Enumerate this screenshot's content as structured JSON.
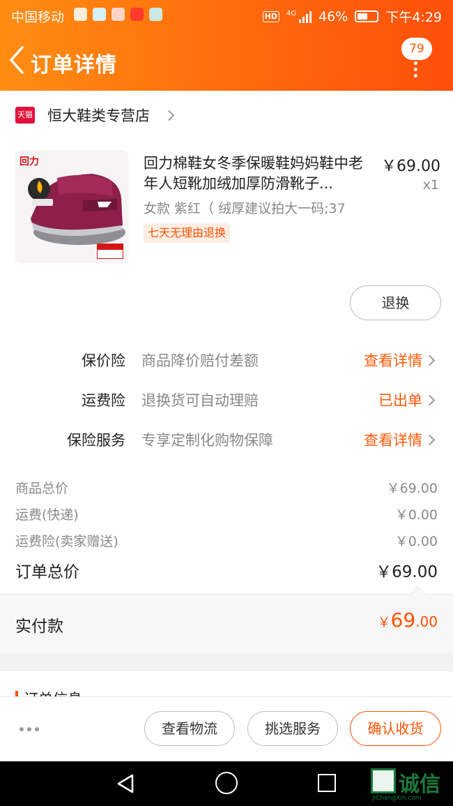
{
  "status_bar": {
    "carrier": "中国移动",
    "hd": "HD",
    "network": "4G",
    "battery": "46%",
    "time": "下午4:29"
  },
  "nav": {
    "title": "订单详情",
    "message_count": "79"
  },
  "shop": {
    "badge": "天猫",
    "name": "恒大鞋类专营店"
  },
  "product": {
    "brand": "回力",
    "title": "回力棉鞋女冬季保暖鞋妈妈鞋中老年人短靴加绒加厚防滑靴子...",
    "price": "￥69.00",
    "quantity": "x1",
    "sku": "女款 紫红（ 绒厚建议拍大一码;37",
    "tag": "七天无理由退换",
    "return_button": "退换"
  },
  "services": [
    {
      "label": "保价险",
      "desc": "商品降价赔付差额",
      "action": "查看详情"
    },
    {
      "label": "运费险",
      "desc": "退换货可自动理赔",
      "action": "已出单"
    },
    {
      "label": "保险服务",
      "desc": "专享定制化购物保障",
      "action": "查看详情"
    }
  ],
  "fees": [
    {
      "label": "商品总价",
      "value": "￥69.00"
    },
    {
      "label": "运费(快递)",
      "value": "￥0.00"
    },
    {
      "label": "运费险(卖家赠送)",
      "value": "￥0.00"
    }
  ],
  "order_total": {
    "label": "订单总价",
    "value": "￥69.00"
  },
  "paid": {
    "label": "实付款",
    "symbol": "￥",
    "integer": "69",
    "decimal": ".00"
  },
  "order_info": {
    "title": "订单信息"
  },
  "actions": {
    "logistics": "查看物流",
    "select_service": "挑选服务",
    "confirm_receipt": "确认收货"
  },
  "watermark": {
    "text": "诚信",
    "sub": "JiChengXin.com"
  },
  "colors": {
    "accent": "#ff5000",
    "header_start": "#ff8d12",
    "header_end": "#ff4f0a"
  }
}
